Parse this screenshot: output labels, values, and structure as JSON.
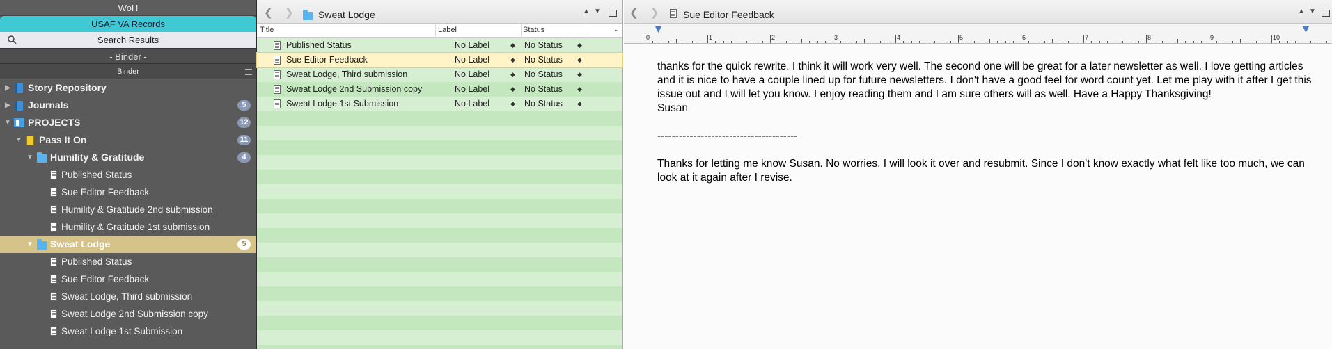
{
  "binder": {
    "collections": {
      "woh": "WoH",
      "va": "USAF VA Records",
      "search": "Search Results",
      "binder_tab": "- Binder -"
    },
    "header": "Binder",
    "items": [
      {
        "label": "Story Repository",
        "badge": ""
      },
      {
        "label": "Journals",
        "badge": "5"
      },
      {
        "label": "PROJECTS",
        "badge": "12"
      },
      {
        "label": "Pass It On",
        "badge": "11"
      },
      {
        "label": "Humility & Gratitude",
        "badge": "4"
      },
      {
        "label": "Published Status"
      },
      {
        "label": "Sue Editor Feedback"
      },
      {
        "label": "Humility & Gratitude 2nd submission"
      },
      {
        "label": "Humility & Gratitude 1st submission"
      },
      {
        "label": "Sweat Lodge",
        "badge": "5"
      },
      {
        "label": "Published Status"
      },
      {
        "label": "Sue Editor Feedback"
      },
      {
        "label": "Sweat Lodge, Third submission"
      },
      {
        "label": "Sweat Lodge 2nd Submission copy"
      },
      {
        "label": "Sweat Lodge 1st Submission"
      }
    ]
  },
  "middle": {
    "title": "Sweat Lodge",
    "columns": {
      "title": "Title",
      "label": "Label",
      "status": "Status"
    },
    "rows": [
      {
        "title": "Published Status",
        "label": "No Label",
        "status": "No Status"
      },
      {
        "title": "Sue Editor Feedback",
        "label": "No Label",
        "status": "No Status"
      },
      {
        "title": "Sweat Lodge, Third submission",
        "label": "No Label",
        "status": "No Status"
      },
      {
        "title": "Sweat Lodge 2nd Submission copy",
        "label": "No Label",
        "status": "No Status"
      },
      {
        "title": "Sweat Lodge 1st Submission",
        "label": "No Label",
        "status": "No Status"
      }
    ]
  },
  "editor": {
    "title": "Sue Editor Feedback",
    "ruler_numbers": [
      "0",
      "1",
      "2",
      "3",
      "4",
      "5",
      "6",
      "7",
      "8",
      "9",
      "10"
    ],
    "paragraphs": [
      "thanks for the quick rewrite. I think it will work very well. The second one will be great for a later newsletter as well. I love getting articles and it is nice to have a couple lined up for future newsletters. I don't have a good feel for word count yet. Let me play with it after I get this issue out and I will let you know. I enjoy reading them and I am sure others will as well.  Have a Happy Thanksgiving!",
      "Susan",
      "",
      "---------------------------------------",
      "",
      "Thanks for letting me know Susan. No worries. I will look it over and resubmit. Since I don't know exactly what felt like too much, we can look at it again after I revise."
    ]
  }
}
